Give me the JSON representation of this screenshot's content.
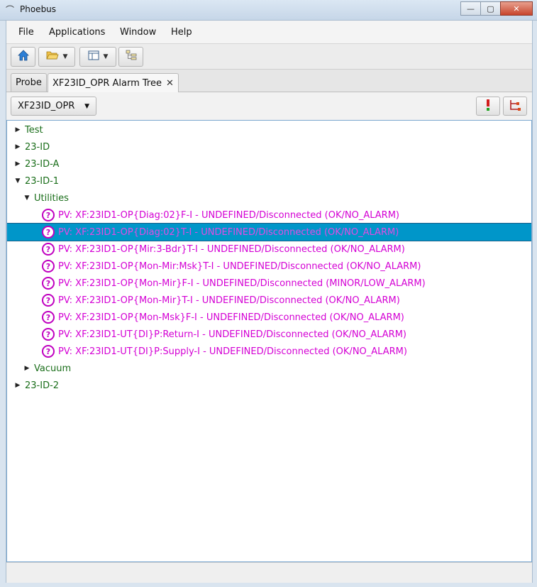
{
  "window": {
    "title": "Phoebus"
  },
  "menu": [
    "File",
    "Applications",
    "Window",
    "Help"
  ],
  "tabs": [
    {
      "label": "Probe",
      "active": false
    },
    {
      "label": "XF23ID_OPR Alarm Tree",
      "active": true,
      "close": "✕"
    }
  ],
  "selector": {
    "value": "XF23ID_OPR"
  },
  "tree": [
    {
      "label": "Test",
      "expanded": false,
      "level": 0,
      "kind": "node"
    },
    {
      "label": "23-ID",
      "expanded": false,
      "level": 0,
      "kind": "node"
    },
    {
      "label": "23-ID-A",
      "expanded": false,
      "level": 0,
      "kind": "node"
    },
    {
      "label": "23-ID-1",
      "expanded": true,
      "level": 0,
      "kind": "node"
    },
    {
      "label": "Utilities",
      "expanded": true,
      "level": 1,
      "kind": "node"
    },
    {
      "label": "PV: XF:23ID1-OP{Diag:02}F-I - UNDEFINED/Disconnected (OK/NO_ALARM)",
      "level": 2,
      "kind": "pv"
    },
    {
      "label": "PV: XF:23ID1-OP{Diag:02}T-I - UNDEFINED/Disconnected (OK/NO_ALARM)",
      "level": 2,
      "kind": "pv",
      "selected": true
    },
    {
      "label": "PV: XF:23ID1-OP{Mir:3-Bdr}T-I - UNDEFINED/Disconnected (OK/NO_ALARM)",
      "level": 2,
      "kind": "pv"
    },
    {
      "label": "PV: XF:23ID1-OP{Mon-Mir:Msk}T-I - UNDEFINED/Disconnected (OK/NO_ALARM)",
      "level": 2,
      "kind": "pv"
    },
    {
      "label": "PV: XF:23ID1-OP{Mon-Mir}F-I - UNDEFINED/Disconnected (MINOR/LOW_ALARM)",
      "level": 2,
      "kind": "pv"
    },
    {
      "label": "PV: XF:23ID1-OP{Mon-Mir}T-I - UNDEFINED/Disconnected (OK/NO_ALARM)",
      "level": 2,
      "kind": "pv"
    },
    {
      "label": "PV: XF:23ID1-OP{Mon-Msk}F-I - UNDEFINED/Disconnected (OK/NO_ALARM)",
      "level": 2,
      "kind": "pv"
    },
    {
      "label": "PV: XF:23ID1-UT{DI}P:Return-I - UNDEFINED/Disconnected (OK/NO_ALARM)",
      "level": 2,
      "kind": "pv"
    },
    {
      "label": "PV: XF:23ID1-UT{DI}P:Supply-I - UNDEFINED/Disconnected (OK/NO_ALARM)",
      "level": 2,
      "kind": "pv"
    },
    {
      "label": "Vacuum",
      "expanded": false,
      "level": 1,
      "kind": "node"
    },
    {
      "label": "23-ID-2",
      "expanded": false,
      "level": 0,
      "kind": "node"
    }
  ],
  "colors": {
    "node": "#1a6e1a",
    "pv": "#d400d4",
    "selection": "#0096c9"
  },
  "icons": [
    "home-icon",
    "open-folder-icon",
    "layout-icon",
    "tree-icon",
    "alarm-icon",
    "tree-config-icon"
  ]
}
